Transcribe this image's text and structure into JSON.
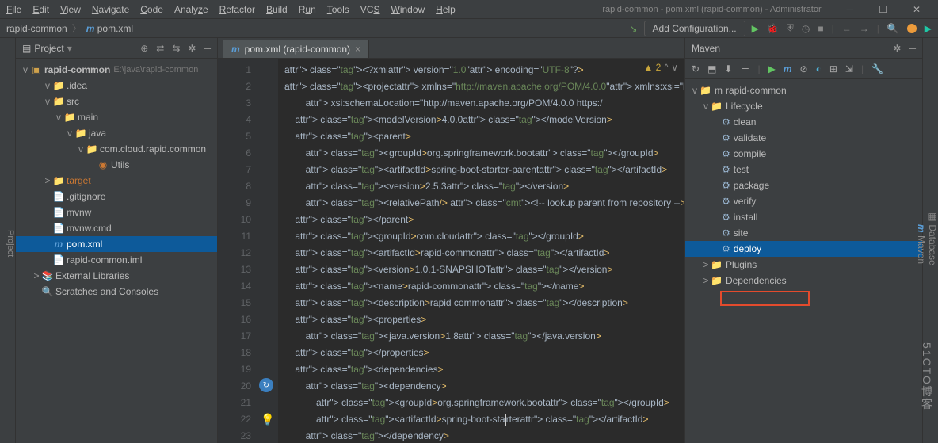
{
  "window": {
    "title": "rapid-common - pom.xml (rapid-common) - Administrator"
  },
  "menu": [
    "File",
    "Edit",
    "View",
    "Navigate",
    "Code",
    "Analyze",
    "Refactor",
    "Build",
    "Run",
    "Tools",
    "VCS",
    "Window",
    "Help"
  ],
  "breadcrumb": {
    "project": "rapid-common",
    "file": "pom.xml"
  },
  "runConfig": {
    "addConfig": "Add Configuration..."
  },
  "projectPanel": {
    "title": "Project",
    "root": {
      "name": "rapid-common",
      "path": "E:\\java\\rapid-common"
    },
    "tree": [
      {
        "depth": 1,
        "tw": "v",
        "icon": "📁",
        "cls": "folder-dim",
        "label": ".idea"
      },
      {
        "depth": 1,
        "tw": "v",
        "icon": "📁",
        "cls": "folder",
        "label": "src"
      },
      {
        "depth": 2,
        "tw": "v",
        "icon": "📁",
        "cls": "folder",
        "label": "main"
      },
      {
        "depth": 3,
        "tw": "v",
        "icon": "📁",
        "cls": "folder",
        "label": "java"
      },
      {
        "depth": 4,
        "tw": "v",
        "icon": "📁",
        "cls": "folder-dim",
        "label": "com.cloud.rapid.common"
      },
      {
        "depth": 5,
        "tw": "",
        "icon": "◉",
        "cls": "util",
        "label": "Utils"
      },
      {
        "depth": 1,
        "tw": ">",
        "icon": "📁",
        "cls": "folder-dim",
        "label": "target",
        "orange": true
      },
      {
        "depth": 1,
        "tw": "",
        "icon": "📄",
        "cls": "file-g",
        "label": ".gitignore"
      },
      {
        "depth": 1,
        "tw": "",
        "icon": "📄",
        "cls": "file-g",
        "label": "mvnw"
      },
      {
        "depth": 1,
        "tw": "",
        "icon": "📄",
        "cls": "file-g",
        "label": "mvnw.cmd"
      },
      {
        "depth": 1,
        "tw": "",
        "icon": "m",
        "cls": "file-m",
        "label": "pom.xml",
        "selected": true
      },
      {
        "depth": 1,
        "tw": "",
        "icon": "📄",
        "cls": "file-g",
        "label": "rapid-common.iml"
      },
      {
        "depth": 0,
        "tw": ">",
        "icon": "📚",
        "cls": "folder-dim",
        "label": "External Libraries"
      },
      {
        "depth": 0,
        "tw": "",
        "icon": "🔍",
        "cls": "folder-dim",
        "label": "Scratches and Consoles"
      }
    ]
  },
  "editorTab": {
    "label": "pom.xml (rapid-common)"
  },
  "status": {
    "warnings": "▲ 2",
    "extra": "^ ∨"
  },
  "code": {
    "lines": [
      "<?xml version=\"1.0\" encoding=\"UTF-8\"?>",
      "<project xmlns=\"http://maven.apache.org/POM/4.0.0\" xmlns:xsi=\"http://",
      "         xsi:schemaLocation=\"http://maven.apache.org/POM/4.0.0 https:/",
      "    <modelVersion>4.0.0</modelVersion>",
      "    <parent>",
      "        <groupId>org.springframework.boot</groupId>",
      "        <artifactId>spring-boot-starter-parent</artifactId>",
      "        <version>2.5.3</version>",
      "        <relativePath/> <!-- lookup parent from repository -->",
      "    </parent>",
      "    <groupId>com.cloud</groupId>",
      "    <artifactId>rapid-common</artifactId>",
      "    <version>1.0.1-SNAPSHOT</version>",
      "    <name>rapid-common</name>",
      "    <description>rapid common</description>",
      "    <properties>",
      "        <java.version>1.8</java.version>",
      "    </properties>",
      "    <dependencies>",
      "        <dependency>",
      "            <groupId>org.springframework.boot</groupId>",
      "            <artifactId>spring-boot-starter</artifactId>",
      "        </dependency>"
    ],
    "firstLine": 1
  },
  "maven": {
    "title": "Maven",
    "root": "rapid-common",
    "lifecycleLabel": "Lifecycle",
    "lifecycle": [
      "clean",
      "validate",
      "compile",
      "test",
      "package",
      "verify",
      "install",
      "site",
      "deploy"
    ],
    "selected": "deploy",
    "plugins": "Plugins",
    "dependencies": "Dependencies"
  },
  "sideTabs": {
    "left": "Project",
    "rightTop": "Database",
    "rightMid": "Maven"
  },
  "watermark": "51CTO博客"
}
